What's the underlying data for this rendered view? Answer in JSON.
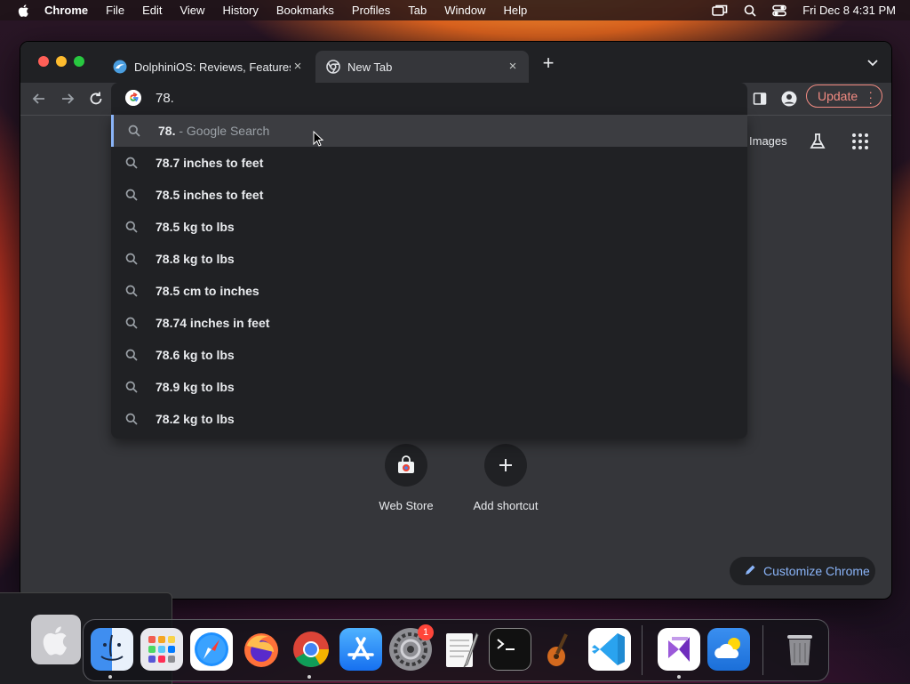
{
  "menubar": {
    "app_name": "Chrome",
    "items": [
      "File",
      "Edit",
      "View",
      "History",
      "Bookmarks",
      "Profiles",
      "Tab",
      "Window",
      "Help"
    ],
    "clock": "Fri Dec 8  4:31 PM"
  },
  "tabs": [
    {
      "title": "DolphiniOS: Reviews, Features,",
      "close": "×",
      "active": false
    },
    {
      "title": "New Tab",
      "close": "×",
      "active": true
    }
  ],
  "newtab_symbol": "+",
  "omnibox": {
    "value": "78.",
    "suggestions": [
      {
        "prefix": "78.",
        "suffix": " - Google Search"
      },
      {
        "text": "78.7 inches to feet"
      },
      {
        "text": "78.5 inches to feet"
      },
      {
        "text": "78.5 kg to lbs"
      },
      {
        "text": "78.8 kg to lbs"
      },
      {
        "text": "78.5 cm to inches"
      },
      {
        "text": "78.74 inches in feet"
      },
      {
        "text": "78.6 kg to lbs"
      },
      {
        "text": "78.9 kg to lbs"
      },
      {
        "text": "78.2 kg to lbs"
      }
    ]
  },
  "toolbar": {
    "update_label": "Update"
  },
  "ntp": {
    "images_link": "Images",
    "shortcuts": [
      {
        "label": "Web Store"
      },
      {
        "label": "Add shortcut"
      }
    ],
    "customize_label": "Customize Chrome"
  },
  "dock": {
    "apps": [
      "finder",
      "launchpad",
      "safari",
      "firefox",
      "chrome",
      "app-store",
      "system-settings",
      "textedit",
      "terminal",
      "garageband",
      "vscode",
      "visual-studio",
      "weather",
      "trash"
    ],
    "settings_badge": "1"
  },
  "colors": {
    "accent": "#8ab4f8",
    "update": "#f28b82",
    "window_bg": "#35363a",
    "omnibox_bg": "#202124"
  }
}
